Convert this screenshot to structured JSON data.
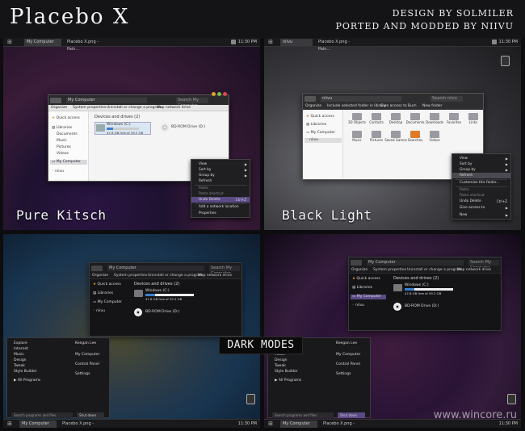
{
  "header": {
    "title": "Placebo X",
    "credit_line1": "DESIGN BY SOLMILER",
    "credit_line2": "PORTED AND MODDED BY NIIVU"
  },
  "taskbar": {
    "active_task": "My Computer",
    "task2": "Placebo X.png - Pain...",
    "clock": "11:30 PM"
  },
  "taskbar_q2": {
    "active_task": "niivu",
    "task2": "Placebo X.png - Pain...",
    "clock": "11:30 PM"
  },
  "captions": {
    "pure_kitsch": "Pure Kitsch",
    "black_light": "Black Light",
    "dark_modes": "DARK MODES"
  },
  "explorer": {
    "breadcrumb": "My Computer",
    "search_placeholder": "Search My Computer",
    "commands": [
      "Organize",
      "System properties",
      "Uninstall or change a program",
      "Map network drive"
    ],
    "sidebar": [
      "Quick access",
      "Libraries",
      "Documents",
      "Music",
      "Pictures",
      "Videos",
      "My Computer",
      "niivu"
    ],
    "sidebar_dark": [
      "Quick access",
      "Libraries",
      "My Computer",
      "niivu"
    ],
    "group_title": "Devices and drives (2)",
    "drive_name": "Windows (C:)",
    "drive_free": "47.8 GB free of 59.3 GB",
    "drive_fill": 0.2,
    "dvd_name": "BD-ROM Drive (D:)"
  },
  "explorer_bl": {
    "breadcrumb": "niivu",
    "search_placeholder": "Search niivu",
    "commands": [
      "Organize",
      "Include selected folder in library",
      "Give access to",
      "Burn",
      "New folder"
    ],
    "sidebar": [
      "Quick access",
      "Libraries",
      "My Computer",
      "niivu"
    ],
    "folders": [
      "3D Objects",
      "Contacts",
      "Desktop",
      "Documents",
      "Downloads",
      "Favorites",
      "Links",
      "Music",
      "Pictures",
      "Saved Games",
      "Searches",
      "Videos"
    ]
  },
  "context_menu_q1": {
    "items": [
      "View",
      "Sort by",
      "Group by",
      "Refresh",
      "Paste",
      "Paste shortcut",
      "Undo Delete",
      "Add a network location",
      "Properties"
    ],
    "shortcut": "Ctrl+Z"
  },
  "context_menu_q2": {
    "items": [
      "View",
      "Sort by",
      "Group by",
      "Refresh",
      "Customize this folder...",
      "Paste",
      "Paste shortcut",
      "Undo Delete",
      "Give access to",
      "New"
    ],
    "shortcut": "Ctrl+Z"
  },
  "start_menu": {
    "left": [
      "Explore",
      "Internet",
      "Music",
      "Design",
      "Tweak",
      "Style Builder"
    ],
    "right": [
      "Keegan Lee",
      "My Computer",
      "Control Panel",
      "Settings"
    ],
    "all_programs": "All Programs",
    "search_placeholder": "Search programs and files",
    "shutdown": "Shut down"
  },
  "watermark": "www.wincore.ru",
  "colors": {
    "accent_purple": "#5b4a86",
    "drive_bar": "#3a7fd0",
    "folder_gray": "#9a9aa0",
    "folder_orange": "#e07b2a"
  }
}
